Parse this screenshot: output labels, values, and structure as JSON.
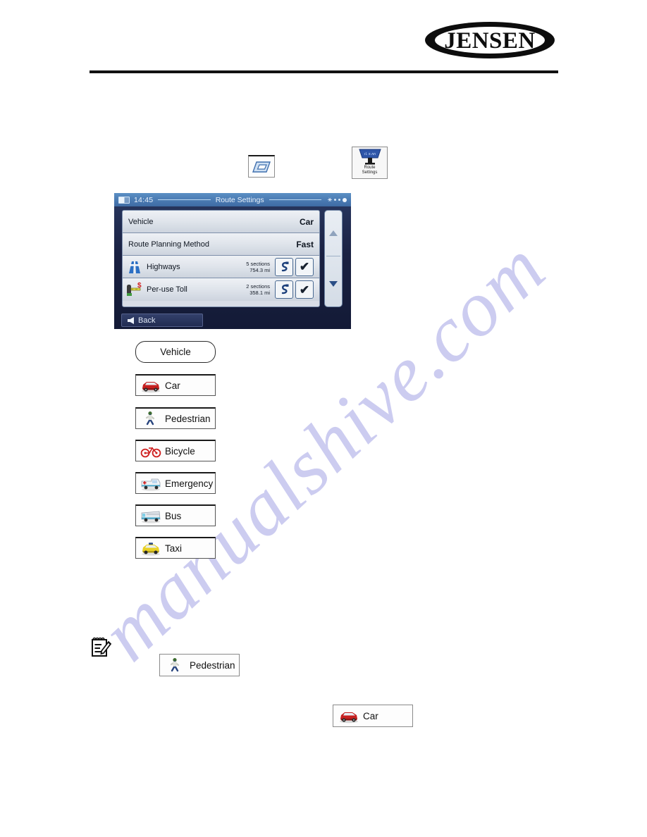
{
  "page": {
    "background_color": "#ffffff",
    "watermark_text": "manualshive.com",
    "watermark_color": "#ccccf0"
  },
  "header": {
    "brand": "JENSEN",
    "brand_registered_mark": "®",
    "rule_color": "#111111"
  },
  "inline_icons": {
    "settings_small": {
      "name": "settings-parallelogram-icon"
    },
    "route_settings": {
      "label": "Route\nSettings",
      "label_line1": "Route",
      "label_line2": "Settings"
    }
  },
  "device_screenshot": {
    "status_bar": {
      "time": "14:45",
      "title": "Route Settings",
      "battery_icon": "battery-icon",
      "satellite_icon": "satellite-icon"
    },
    "rows": [
      {
        "type": "value",
        "label": "Vehicle",
        "value": "Car"
      },
      {
        "type": "value",
        "label": "Route Planning Method",
        "value": "Fast"
      },
      {
        "type": "toggle",
        "icon": "highway-icon",
        "label": "Highways",
        "sections": "5 sections",
        "distance": "754.3 mi",
        "detour_button": "detour-icon",
        "checked": true
      },
      {
        "type": "toggle",
        "icon": "toll-booth-icon",
        "label": "Per-use Toll",
        "sections": "2 sections",
        "distance": "358.1 mi",
        "detour_button": "detour-icon",
        "checked": true
      }
    ],
    "scrollbar": {
      "up_arrow": "scroll-up-arrow",
      "down_arrow": "scroll-down-arrow"
    },
    "back_button": {
      "label": "Back",
      "icon": "back-arrow-icon"
    },
    "colors": {
      "bezel": "#1c2545",
      "title_bar": "#4a7ab2",
      "list_row": "#dfe4eb"
    }
  },
  "vehicle_section": {
    "heading_button": {
      "label": "Vehicle"
    },
    "options": [
      {
        "label": "Car",
        "icon": "car-icon"
      },
      {
        "label": "Pedestrian",
        "icon": "pedestrian-icon"
      },
      {
        "label": "Bicycle",
        "icon": "bicycle-icon"
      },
      {
        "label": "Emergency",
        "icon": "ambulance-icon"
      },
      {
        "label": "Bus",
        "icon": "bus-icon"
      },
      {
        "label": "Taxi",
        "icon": "taxi-icon"
      }
    ]
  },
  "note_section": {
    "note_icon": "notepad-pencil-icon",
    "pedestrian_button": {
      "label": "Pedestrian",
      "icon": "pedestrian-icon"
    },
    "car_button": {
      "label": "Car",
      "icon": "car-icon"
    }
  }
}
